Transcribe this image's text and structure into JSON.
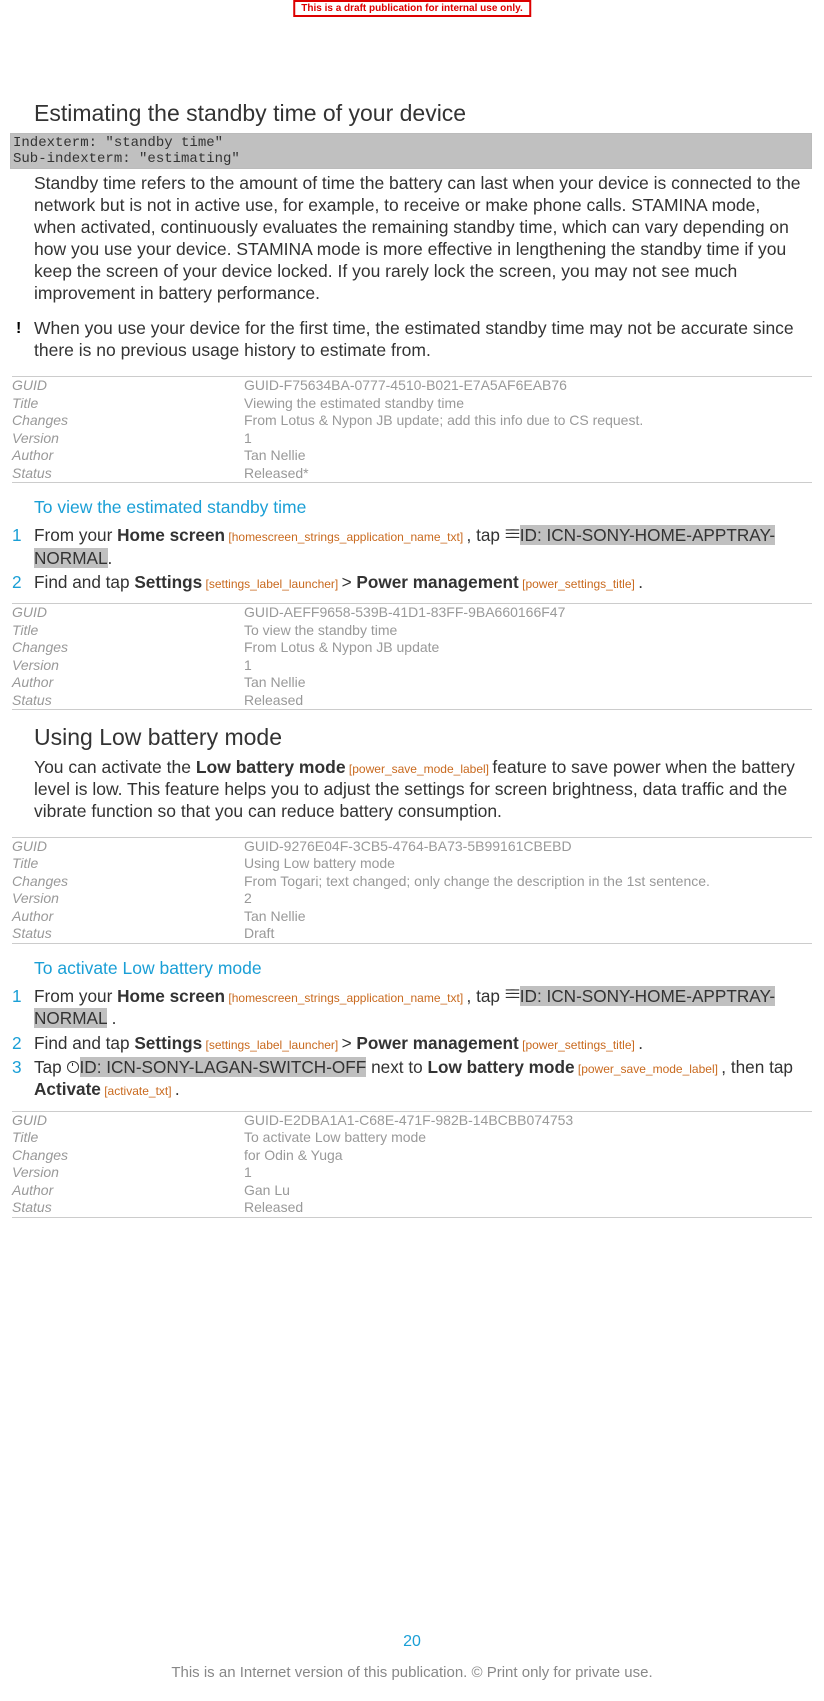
{
  "banner": "This is a draft publication for internal use only.",
  "section1": {
    "heading": "Estimating the standby time of your device",
    "indexterm_line1": "Indexterm: \"standby time\"",
    "indexterm_line2": "Sub-indexterm: \"estimating\"",
    "body": "Standby time refers to the amount of time the battery can last when your device is connected to the network but is not in active use, for example, to receive or make phone calls. STAMINA mode, when activated, continuously evaluates the remaining standby time, which can vary depending on how you use your device. STAMINA mode is more effective in lengthening the standby time if you keep the screen of your device locked. If you rarely lock the screen, you may not see much improvement in battery performance.",
    "note": "When you use your device for the first time, the estimated standby time may not be accurate since there is no previous usage history to estimate from."
  },
  "meta_labels": {
    "guid": "GUID",
    "title": "Title",
    "changes": "Changes",
    "version": "Version",
    "author": "Author",
    "status": "Status"
  },
  "meta1": {
    "guid": "GUID-F75634BA-0777-4510-B021-E7A5AF6EAB76",
    "title": "Viewing the estimated standby time",
    "changes": "From Lotus & Nypon JB update; add this info due to CS request.",
    "version": "1",
    "author": "Tan Nellie",
    "status": "Released*"
  },
  "subheading1": "To view the estimated standby time",
  "steps1": {
    "s1_pre": "From your ",
    "s1_homescreen": "Home screen",
    "s1_ref1": " [homescreen_strings_application_name_txt] ",
    "s1_tap": ", tap ",
    "s1_idtxt": "ID: ICN-SONY-HOME-APPTRAY-NORMAL",
    "s1_post": ".",
    "s2_pre": "Find and tap ",
    "s2_settings": "Settings",
    "s2_ref1": " [settings_label_launcher] ",
    "s2_gt": "> ",
    "s2_power": "Power management",
    "s2_ref2": " [power_settings_title] ",
    "s2_post": "."
  },
  "meta2": {
    "guid": "GUID-AEFF9658-539B-41D1-83FF-9BA660166F47",
    "title": "To view the standby time",
    "changes": "From Lotus & Nypon JB update",
    "version": "1",
    "author": "Tan Nellie",
    "status": "Released"
  },
  "section2": {
    "heading": "Using Low battery mode",
    "body_pre": "You can activate the ",
    "body_bold": "Low battery mode",
    "body_ref": " [power_save_mode_label] ",
    "body_post": "feature to save power when the battery level is low. This feature helps you to adjust the settings for screen brightness, data traffic and the vibrate function so that you can reduce battery consumption."
  },
  "meta3": {
    "guid": "GUID-9276E04F-3CB5-4764-BA73-5B99161CBEBD",
    "title": "Using Low battery mode",
    "changes": "From Togari; text changed; only change the description in the 1st sentence.",
    "version": "2",
    "author": "Tan Nellie",
    "status": "Draft"
  },
  "subheading2": "To activate Low battery mode",
  "steps2": {
    "s1_pre": "From your ",
    "s1_homescreen": "Home screen",
    "s1_ref1": " [homescreen_strings_application_name_txt] ",
    "s1_tap": ", tap ",
    "s1_idtxt": "ID: ICN-SONY-HOME-APPTRAY-NORMAL",
    "s1_post": " .",
    "s2_pre": "Find and tap ",
    "s2_settings": "Settings",
    "s2_ref1": " [settings_label_launcher] ",
    "s2_gt": "> ",
    "s2_power": "Power management",
    "s2_ref2": " [power_settings_title] ",
    "s2_post": ".",
    "s3_pre": "Tap ",
    "s3_idtxt": "ID: ICN-SONY-LAGAN-SWITCH-OFF",
    "s3_mid": " next to ",
    "s3_lowbat": "Low battery mode",
    "s3_ref1": " [power_save_mode_label] ",
    "s3_then": ", then tap ",
    "s3_activate": "Activate",
    "s3_ref2": " [activate_txt] ",
    "s3_post": "."
  },
  "meta4": {
    "guid": "GUID-E2DBA1A1-C68E-471F-982B-14BCBB074753",
    "title": "To activate Low battery mode",
    "changes": "for Odin & Yuga",
    "version": "1",
    "author": "Gan Lu",
    "status": "Released"
  },
  "page_number": "20",
  "footer": "This is an Internet version of this publication. © Print only for private use."
}
